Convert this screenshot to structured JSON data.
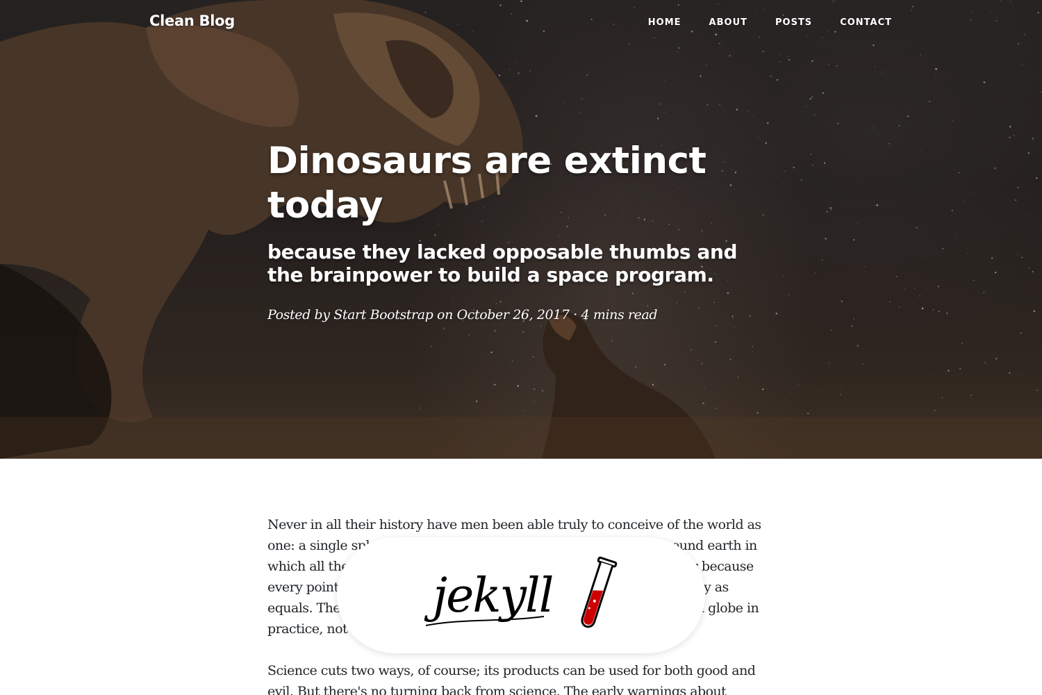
{
  "nav": {
    "brand": "Clean Blog",
    "links": [
      "HOME",
      "ABOUT",
      "POSTS",
      "CONTACT"
    ]
  },
  "post": {
    "title": "Dinosaurs are extinct today",
    "subtitle": "because they lacked opposable thumbs and the brainpower to build a space program.",
    "meta_prefix": "Posted by",
    "author": "Start Bootstrap",
    "meta_on": "on",
    "date": "October 26, 2017",
    "separator": "·",
    "read_time": "4 mins read"
  },
  "article": {
    "paragraphs": [
      "Never in all their history have men been able truly to conceive of the world as one: a single sphere, a globe, having the qualities of a globe, a round earth in which all the directions eventually meet, in which there is no center because every point, or none, is center — an equal earth which all men occupy as equals. The airman's earth, if free men make it, will be truly round: a globe in practice, not in theory.",
      "Science cuts two ways, of course; its products can be used for both good and evil. But there's no turning back from science. The early warnings about"
    ]
  },
  "badge": {
    "logo_text": "jekyll",
    "icon": "test-tube-icon",
    "liquid_color": "#cc0000"
  },
  "colors": {
    "hero_text": "#ffffff",
    "body_text": "#212529"
  }
}
